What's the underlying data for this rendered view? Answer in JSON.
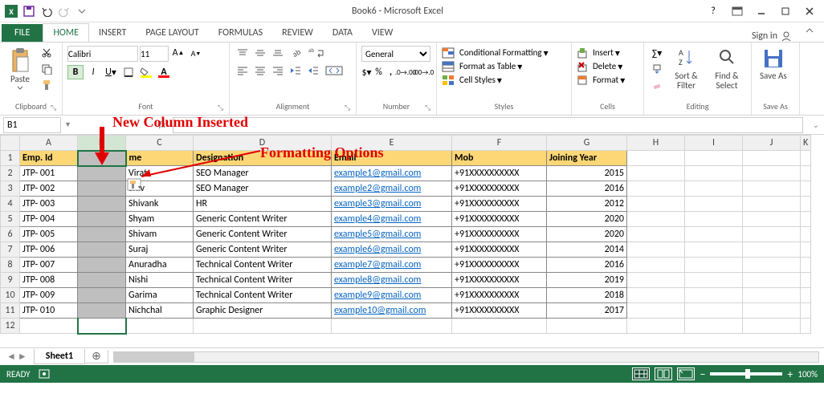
{
  "window": {
    "title": "Book6 - Microsoft Excel"
  },
  "ribbon_tabs": {
    "file": "FILE",
    "home": "HOME",
    "insert": "INSERT",
    "page_layout": "PAGE LAYOUT",
    "formulas": "FORMULAS",
    "review": "REVIEW",
    "data": "DATA",
    "view": "VIEW",
    "signin": "Sign in"
  },
  "ribbon": {
    "clipboard": {
      "paste": "Paste",
      "label": "Clipboard"
    },
    "font": {
      "name": "Calibri",
      "size": "11",
      "label": "Font"
    },
    "alignment": {
      "label": "Alignment"
    },
    "number": {
      "format": "General",
      "label": "Number"
    },
    "styles": {
      "cond": "Conditional Formatting",
      "table": "Format as Table",
      "cell": "Cell Styles",
      "label": "Styles"
    },
    "cells": {
      "insert": "Insert",
      "delete": "Delete",
      "format": "Format",
      "label": "Cells"
    },
    "editing": {
      "sort": "Sort & Filter",
      "find": "Find & Select",
      "label": "Editing"
    },
    "saveas": {
      "btn": "Save As",
      "label": "Save As"
    }
  },
  "namebox": "B1",
  "annotations": {
    "new_col": "New Column Inserted",
    "fmt": "Formatting Options"
  },
  "columns": [
    "",
    "A",
    "B",
    "C",
    "D",
    "E",
    "F",
    "G",
    "H",
    "I",
    "J",
    "K"
  ],
  "headers": {
    "A": "Emp. Id",
    "B": "",
    "C": "me",
    "D": "Designation",
    "E": "Email",
    "F": "Mob",
    "G": "Joining Year"
  },
  "rows": [
    {
      "n": 2,
      "A": "JTP- 001",
      "C": "Virat",
      "D": "SEO Manager",
      "E": "example1@gmail.com",
      "F": "+91XXXXXXXXXX",
      "G": "2015"
    },
    {
      "n": 3,
      "A": "JTP- 002",
      "C": "Shiv",
      "D": "SEO Manager",
      "E": "example2@gmail.com",
      "F": "+91XXXXXXXXXX",
      "G": "2016"
    },
    {
      "n": 4,
      "A": "JTP- 003",
      "C": "Shivank",
      "D": "HR",
      "E": "example3@gmail.com",
      "F": "+91XXXXXXXXXX",
      "G": "2012"
    },
    {
      "n": 5,
      "A": "JTP- 004",
      "C": "Shyam",
      "D": "Generic Content Writer",
      "E": "example4@gmail.com",
      "F": "+91XXXXXXXXXX",
      "G": "2020"
    },
    {
      "n": 6,
      "A": "JTP- 005",
      "C": "Shivam",
      "D": "Generic Content Writer",
      "E": "example5@gmail.com",
      "F": "+91XXXXXXXXXX",
      "G": "2020"
    },
    {
      "n": 7,
      "A": "JTP- 006",
      "C": "Suraj",
      "D": "Generic Content Writer",
      "E": "example6@gmail.com",
      "F": "+91XXXXXXXXXX",
      "G": "2014"
    },
    {
      "n": 8,
      "A": "JTP- 007",
      "C": "Anuradha",
      "D": "Technical Content Writer",
      "E": "example7@gmail.com",
      "F": "+91XXXXXXXXXX",
      "G": "2016"
    },
    {
      "n": 9,
      "A": "JTP- 008",
      "C": "Nishi",
      "D": "Technical Content Writer",
      "E": "example8@gmail.com",
      "F": "+91XXXXXXXXXX",
      "G": "2019"
    },
    {
      "n": 10,
      "A": "JTP- 009",
      "C": "Garima",
      "D": "Technical Content Writer",
      "E": "example9@gmail.com",
      "F": "+91XXXXXXXXXX",
      "G": "2018"
    },
    {
      "n": 11,
      "A": "JTP- 010",
      "C": "Nichchal",
      "D": "Graphic Designer",
      "E": "example10@gmail.com",
      "F": "+91XXXXXXXXXX",
      "G": "2017"
    }
  ],
  "sheet_tab": "Sheet1",
  "status": {
    "ready": "READY",
    "zoom": "100%"
  }
}
